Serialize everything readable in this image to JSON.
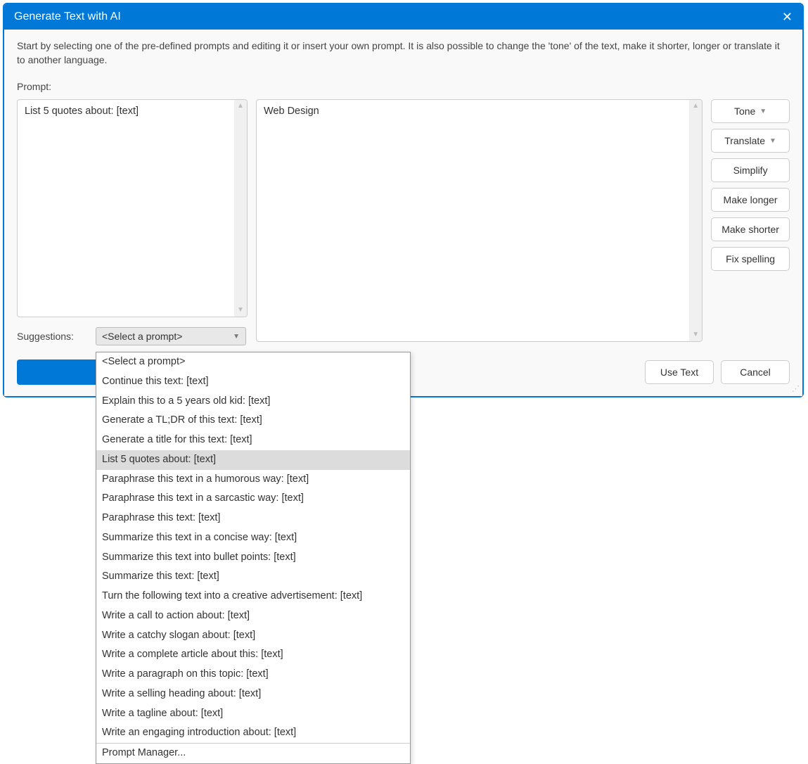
{
  "title": "Generate Text with AI",
  "intro": "Start by selecting one of the pre-defined prompts and editing it or insert your own prompt. It is also possible to change the 'tone' of the text, make it shorter, longer or translate it to another language.",
  "prompt_label": "Prompt:",
  "prompt_text": "List 5 quotes about: [text]",
  "result_text": "Web Design",
  "side_buttons": {
    "tone": "Tone",
    "translate": "Translate",
    "simplify": "Simplify",
    "make_longer": "Make longer",
    "make_shorter": "Make shorter",
    "fix_spelling": "Fix spelling"
  },
  "suggestions_label": "Suggestions:",
  "combo_value": "<Select a prompt>",
  "use_text_label": "Use Text",
  "cancel_label": "Cancel",
  "dropdown": {
    "items": [
      "<Select a prompt>",
      "Continue this text: [text]",
      "Explain this to a 5 years old kid: [text]",
      "Generate a TL;DR of this text: [text]",
      "Generate a title for this text: [text]",
      "List 5 quotes about: [text]",
      "Paraphrase this text in a humorous way: [text]",
      "Paraphrase this text in a sarcastic way: [text]",
      "Paraphrase this text: [text]",
      "Summarize this text in a concise way: [text]",
      "Summarize this text into bullet points: [text]",
      "Summarize this text: [text]",
      "Turn the following text into a creative advertisement: [text]",
      "Write a call to action about: [text]",
      "Write a catchy slogan about: [text]",
      "Write a complete article about this: [text]",
      "Write a paragraph on this topic: [text]",
      "Write a selling heading about: [text]",
      "Write a tagline about: [text]",
      "Write an engaging introduction about: [text]"
    ],
    "selected_index": 5,
    "footer_item": "Prompt Manager..."
  }
}
